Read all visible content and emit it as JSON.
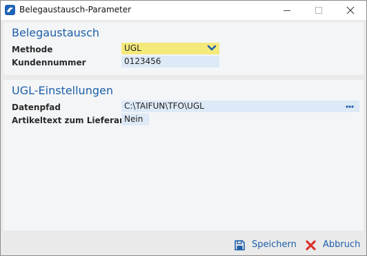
{
  "window": {
    "title": "Belegaustausch-Parameter",
    "icons": [
      "app-logo-icon",
      "minimize-icon",
      "maximize-icon",
      "close-icon"
    ]
  },
  "belegaustausch": {
    "heading": "Belegaustausch",
    "methode_label": "Methode",
    "methode_value": "UGL",
    "kundennummer_label": "Kundennummer",
    "kundennummer_value": "0123456"
  },
  "ugl": {
    "heading": "UGL-Einstellungen",
    "datenpfad_label": "Datenpfad",
    "datenpfad_value": "C:\\TAIFUN\\TFO\\UGL",
    "artikeltext_label": "Artikeltext zum Lieferant",
    "artikeltext_value": "Nein"
  },
  "footer": {
    "save_label": "Speichern",
    "cancel_label": "Abbruch"
  },
  "colors": {
    "accent": "#1c5fa8",
    "field_bg": "#dde9f6",
    "field_highlight": "#f4e97b",
    "cancel_icon": "#d9322a"
  }
}
